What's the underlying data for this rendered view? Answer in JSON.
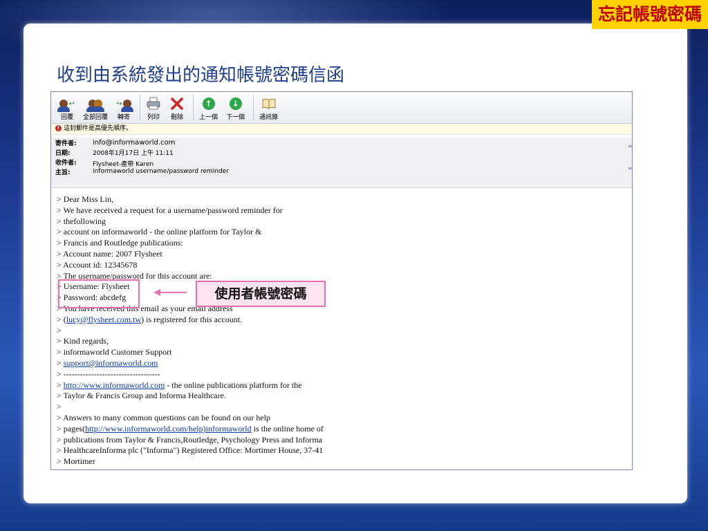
{
  "badge": "忘記帳號密碼",
  "slide_title": "收到由系統發出的通知帳號密碼信函",
  "toolbar": [
    {
      "label": "回覆",
      "icon": "reply-icon"
    },
    {
      "label": "全部回覆",
      "icon": "reply-all-icon"
    },
    {
      "label": "轉寄",
      "icon": "forward-icon"
    },
    {
      "label": "列印",
      "icon": "print-icon"
    },
    {
      "label": "刪除",
      "icon": "delete-icon"
    },
    {
      "label": "上一個",
      "icon": "previous-icon"
    },
    {
      "label": "下一個",
      "icon": "next-icon"
    },
    {
      "label": "通訊錄",
      "icon": "address-book-icon"
    }
  ],
  "priority_notice": "這封郵件是高優先順序。",
  "headers": {
    "from_label": "寄件者:",
    "from": "info@informaworld.com",
    "date_label": "日期:",
    "date": "2008年1月17日 上午 11:11",
    "to_label": "收件者:",
    "to": "Flysheet-產帶 Karen",
    "subject_label": "主旨:",
    "subject": "informaworld username/password reminder"
  },
  "body_lines": [
    "> Dear Miss Lin,",
    "> We have received a request for a username/password reminder for",
    "> thefollowing",
    "> account on informaworld - the online platform for Taylor &",
    "> Francis and Routledge publications:",
    "> Account name: 2007 Flysheet",
    "> Account id: 12345678",
    "> The username/password for this account are:",
    "> Username: Flysheet",
    "> Password: abcdefg",
    "> You have received this email as your email address",
    "> (",
    "lucy@flysheet.com.tw",
    ") is registered for this account.",
    ">",
    "> Kind regards,",
    "> informaworld Customer Support",
    "> ",
    "support@informaworld.com",
    "> -----------------------------------",
    "> ",
    "http://www.informaworld.com",
    " - the online publications platform for the",
    "> Taylor & Francis Group and Informa Healthcare.",
    ">",
    "> Answers to many common questions can be found on our help",
    "> pages(",
    "http://www.informaworld.com/help)informaworld",
    " is the online home of",
    "> publications from Taylor & Francis,Routledge, Psychology Press and Informa",
    "> HealthcareInforma plc (\"Informa\") Registered Office: Mortimer House, 37-41",
    "> Mortimer"
  ],
  "callout": "使用者帳號密碼",
  "colors": {
    "badge_bg": "#ffd200",
    "badge_text": "#c00000",
    "title": "#1f3f8a",
    "highlight": "#e86fb0",
    "link": "#0a3aa8"
  }
}
